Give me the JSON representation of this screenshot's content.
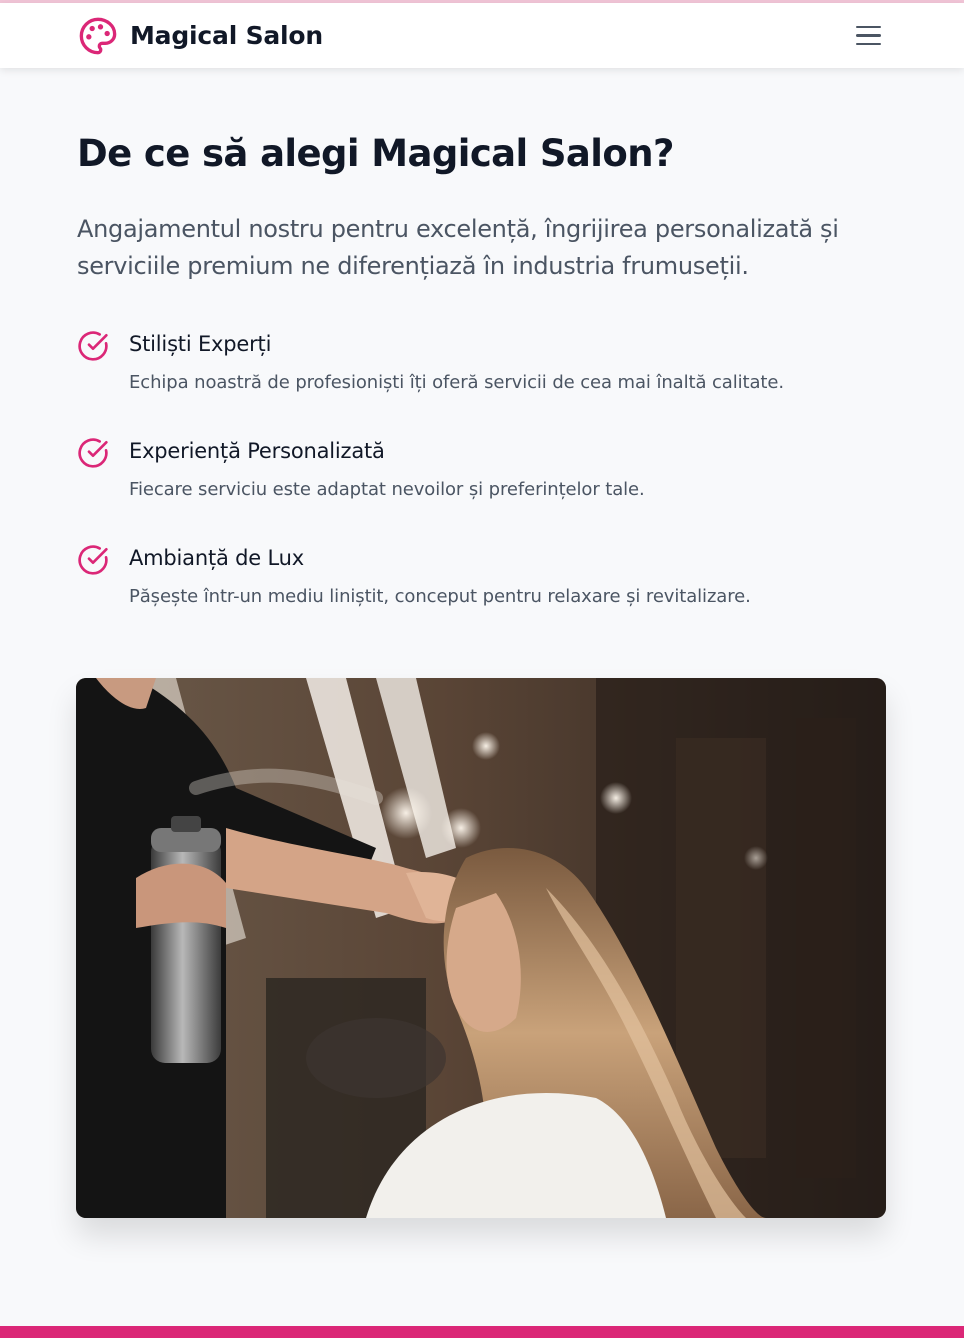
{
  "header": {
    "brand": "Magical Salon",
    "logo_icon": "palette-icon",
    "menu_icon": "hamburger-menu-icon"
  },
  "section": {
    "title": "De ce să alegi Magical Salon?",
    "lead": "Angajamentul nostru pentru excelență, îngrijirea personalizată și serviciile premium ne diferențiază în industria frumuseții.",
    "features": [
      {
        "icon": "check-circle-icon",
        "title": "Stiliști Experți",
        "text": "Echipa noastră de profesioniști îți oferă servicii de cea mai înaltă calitate."
      },
      {
        "icon": "check-circle-icon",
        "title": "Experiență Personalizată",
        "text": "Fiecare serviciu este adaptat nevoilor și preferințelor tale."
      },
      {
        "icon": "check-circle-icon",
        "title": "Ambianță de Lux",
        "text": "Pășește într-un mediu liniștit, conceput pentru relaxare și revitalizare."
      }
    ]
  },
  "colors": {
    "accent": "#db2777",
    "text": "#111827",
    "muted": "#4b5563",
    "background": "#f8f9fb"
  }
}
